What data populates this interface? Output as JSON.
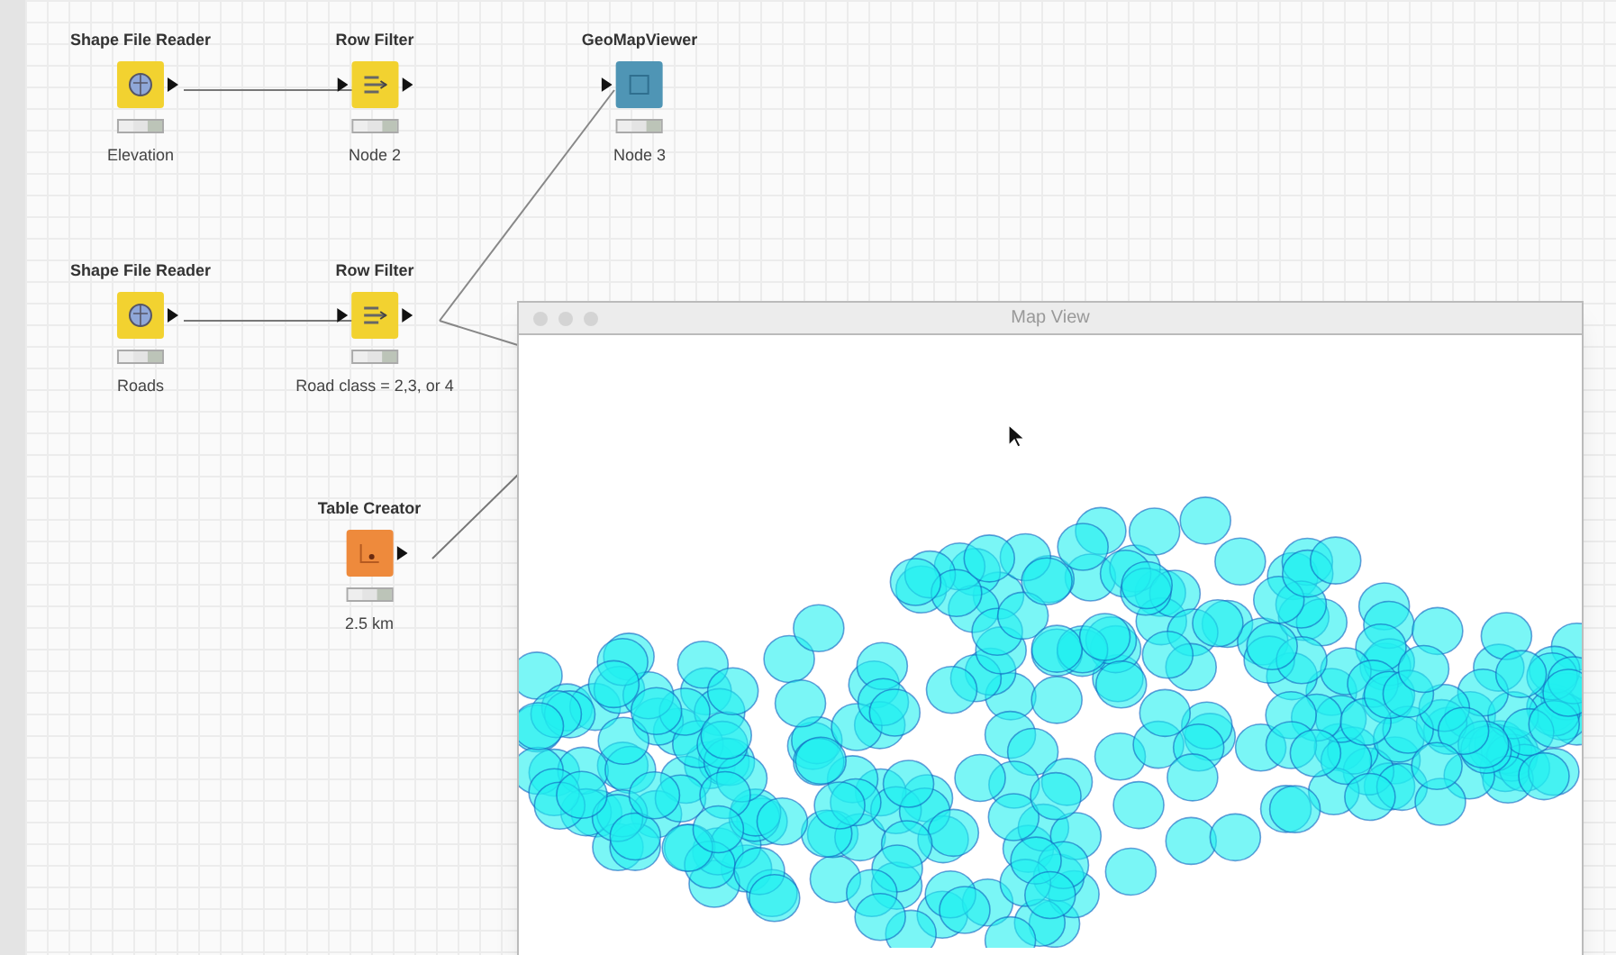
{
  "workflow": {
    "nodes": [
      {
        "kind": "reader",
        "title": "Shape File Reader",
        "name": "Elevation"
      },
      {
        "kind": "filter",
        "title": "Row Filter",
        "name": "Node 2"
      },
      {
        "kind": "viewer",
        "title": "GeoMapViewer",
        "name": "Node 3"
      },
      {
        "kind": "reader",
        "title": "Shape File Reader",
        "name": "Roads"
      },
      {
        "kind": "filter",
        "title": "Row Filter",
        "name": "Road class = 2,3, or 4"
      },
      {
        "kind": "creator",
        "title": "Table Creator",
        "name": "2.5 km"
      }
    ]
  },
  "map_window": {
    "title": "Map View"
  }
}
